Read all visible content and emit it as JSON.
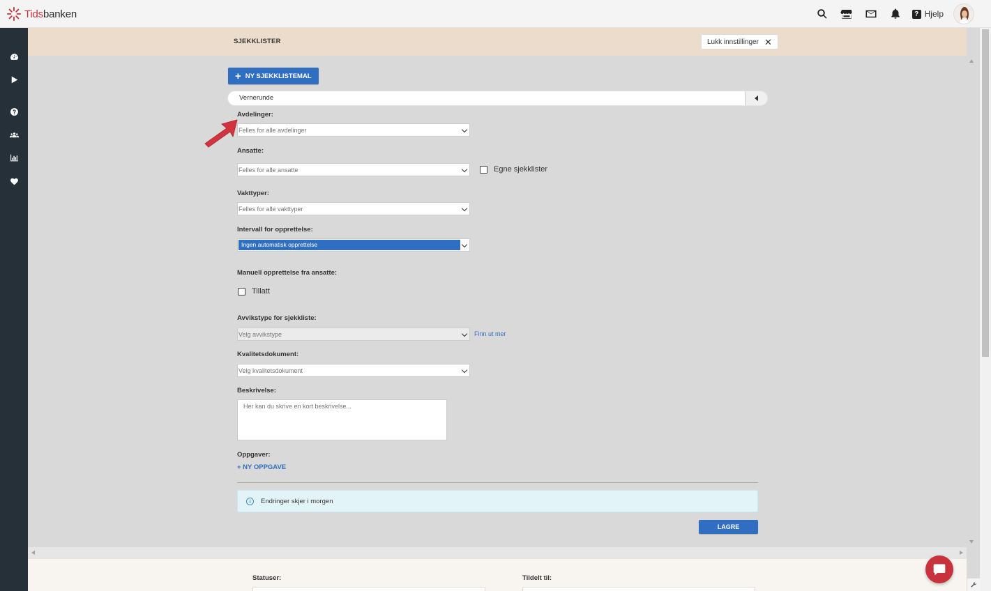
{
  "app": {
    "logo_brand_red": "Tids",
    "logo_brand_dark": "banken",
    "help_label": "Hjelp"
  },
  "settings": {
    "title": "SJEKKLISTER",
    "close_label": "Lukk innstillinger"
  },
  "form": {
    "new_template_label": "NY SJEKKLISTEMAL",
    "template_name": "Vernerunde",
    "departments_label": "Avdelinger:",
    "departments_value": "Felles for alle avdelinger",
    "employees_label": "Ansatte:",
    "employees_value": "Felles for alle ansatte",
    "own_checklists_label": "Egne sjekklister",
    "shift_types_label": "Vakttyper:",
    "shift_types_value": "Felles for alle vakttyper",
    "interval_label": "Intervall for opprettelse:",
    "interval_value": "Ingen automatisk opprettelse",
    "manual_label": "Manuell opprettelse fra ansatte:",
    "allowed_label": "Tillatt",
    "deviation_label": "Avvikstype for sjekkliste:",
    "deviation_value": "Velg avvikstype",
    "learn_more": "Finn ut mer",
    "quality_label": "Kvalitetsdokument:",
    "quality_value": "Velg kvalitetsdokument",
    "description_label": "Beskrivelse:",
    "description_placeholder": "Her kan du skrive en kort beskrivelse...",
    "tasks_label": "Oppgaver:",
    "new_task_label": "+ NY OPPGAVE",
    "info_text": "Endringer skjer i morgen",
    "save_label": "LAGRE"
  },
  "bottom": {
    "statuses_label": "Statuser:",
    "assigned_label": "Tildelt til:"
  },
  "colors": {
    "primary": "#2f6ec0",
    "sidebar": "#253038",
    "band": "#ebdccb",
    "accent_red": "#c8323c"
  },
  "icons": {
    "top": [
      "search-icon",
      "store-icon",
      "mail-icon",
      "bell-icon",
      "help-icon"
    ],
    "sidebar": [
      "dashboard-icon",
      "play-icon",
      "question-icon",
      "users-icon",
      "chart-icon",
      "heart-icon"
    ]
  }
}
